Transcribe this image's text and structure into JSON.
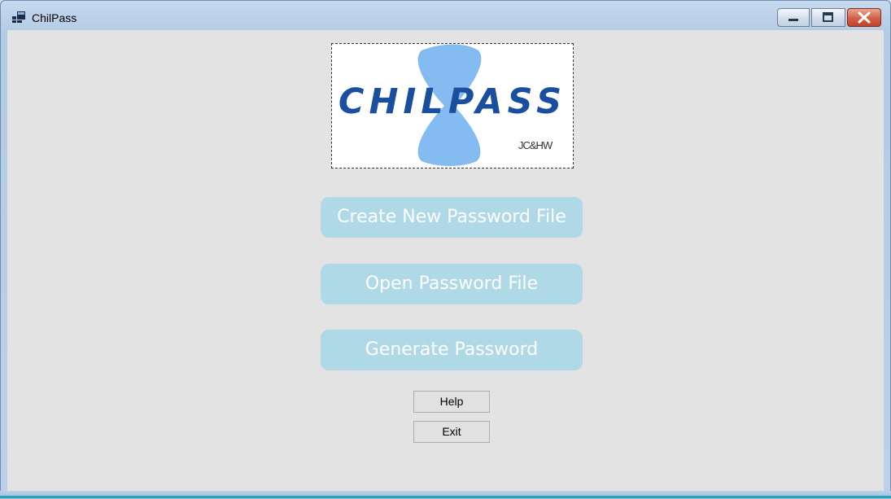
{
  "window": {
    "title": "ChilPass",
    "controls": {
      "minimize_icon": "minimize-icon",
      "maximize_icon": "maximize-icon",
      "close_icon": "close-icon"
    }
  },
  "logo": {
    "wordmark": "CHILPASS",
    "credit": "JC&HW",
    "colors": {
      "text": "#1a4fa0",
      "shape": "#84bbf0"
    }
  },
  "buttons": {
    "create_new": "Create New Password File",
    "open": "Open Password File",
    "generate": "Generate Password",
    "help": "Help",
    "exit": "Exit"
  },
  "colors": {
    "primary_button_bg": "#afd9e6",
    "primary_button_text": "#ffffff",
    "client_bg": "#e3e3e3"
  }
}
